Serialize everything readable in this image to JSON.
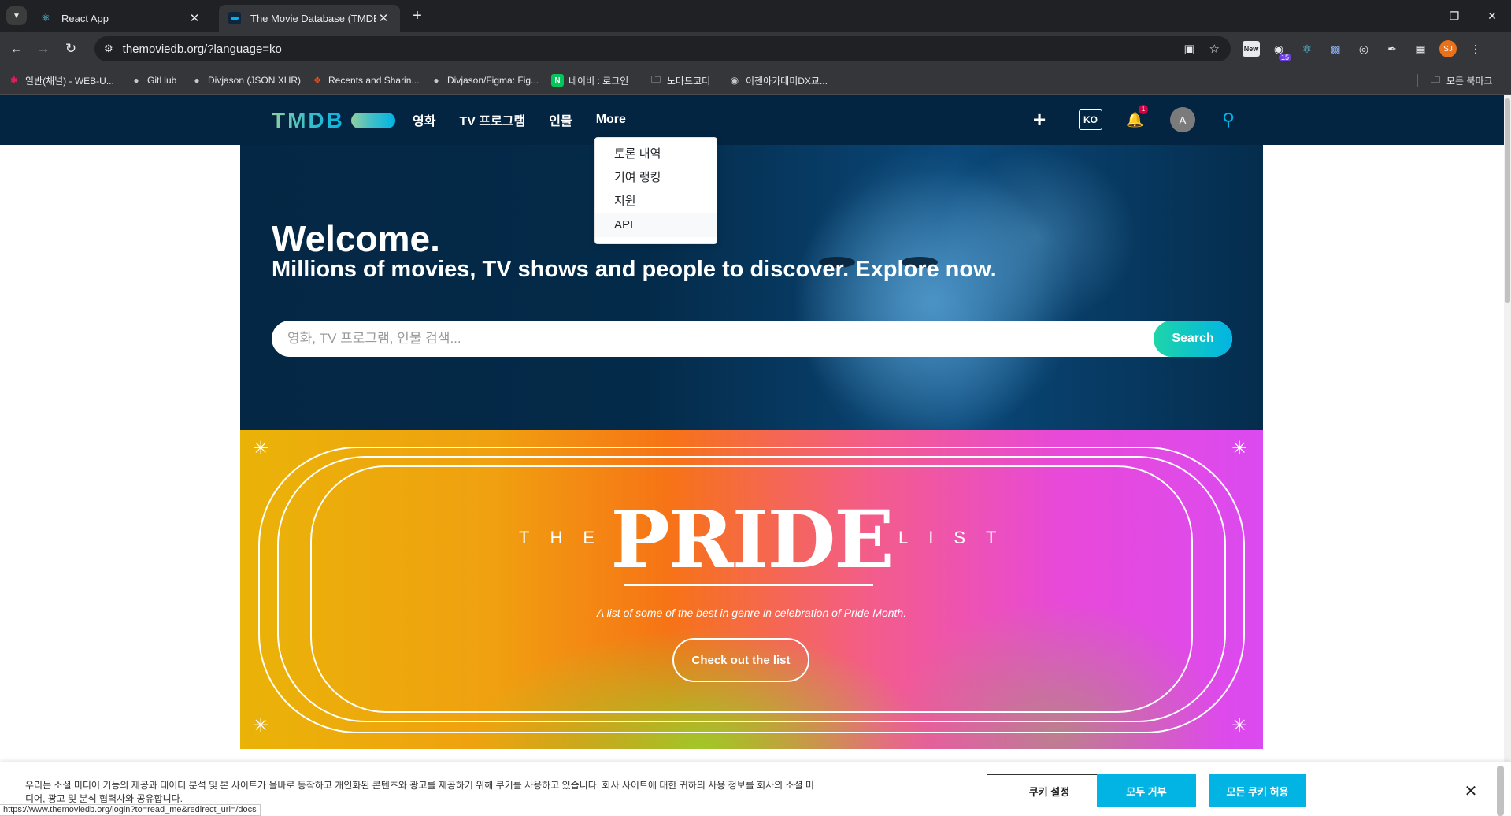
{
  "browser": {
    "tabs": [
      {
        "title": "React App",
        "icon": "react-icon"
      },
      {
        "title": "The Movie Database (TMDB)",
        "icon": "tmdb-icon"
      }
    ],
    "url": "themoviedb.org/?language=ko",
    "bookmarks": [
      {
        "label": "일반(채널) - WEB-U...",
        "icon": "slack-icon"
      },
      {
        "label": "GitHub",
        "icon": "github-icon"
      },
      {
        "label": "Divjason (JSON XHR)",
        "icon": "github-icon"
      },
      {
        "label": "Recents and Sharin...",
        "icon": "figma-icon"
      },
      {
        "label": "Divjason/Figma: Fig...",
        "icon": "github-icon"
      },
      {
        "label": "네이버 : 로그인",
        "icon": "naver-icon"
      },
      {
        "label": "노마드코더",
        "icon": "folder-icon"
      },
      {
        "label": "이젠아카데미DX교...",
        "icon": "globe-icon"
      }
    ],
    "all_bookmarks": "모든 북마크",
    "extensions": {
      "new_label": "New",
      "badge_count": "15",
      "profile_initials": "SJ"
    },
    "status_url": "https://www.themoviedb.org/login?to=read_me&redirect_uri=/docs"
  },
  "header": {
    "logo": "TMDB",
    "nav": [
      "영화",
      "TV 프로그램",
      "인물",
      "More"
    ],
    "lang": "KO",
    "notification_count": "1",
    "avatar_initial": "A",
    "brand_colors": {
      "navy": "#032541",
      "light_blue": "#01b4e4",
      "green": "#90cea1"
    }
  },
  "dropdown": {
    "items": [
      "토론 내역",
      "기여 랭킹",
      "지원",
      "API"
    ]
  },
  "hero": {
    "title": "Welcome.",
    "subtitle": "Millions of movies, TV shows and people to discover. Explore now.",
    "search_placeholder": "영화, TV 프로그램, 인물 검색...",
    "search_button": "Search"
  },
  "pride": {
    "the": "THE",
    "word": "PRIDE",
    "list": "LIST",
    "description": "A list of some of the best in genre in celebration of Pride Month.",
    "button": "Check out the list"
  },
  "cookie": {
    "text": "우리는 소셜 미디어 기능의 제공과 데이터 분석 및 본 사이트가 올바로 동작하고 개인화된 콘텐츠와 광고를 제공하기 위해 쿠키를 사용하고 있습니다. 회사 사이트에 대한 귀하의 사용 정보를 회사의 소셜 미디어, 광고 및 분석 협력사와 공유합니다.",
    "settings": "쿠키 설정",
    "reject": "모두 거부",
    "accept": "모든 쿠키 허용"
  }
}
